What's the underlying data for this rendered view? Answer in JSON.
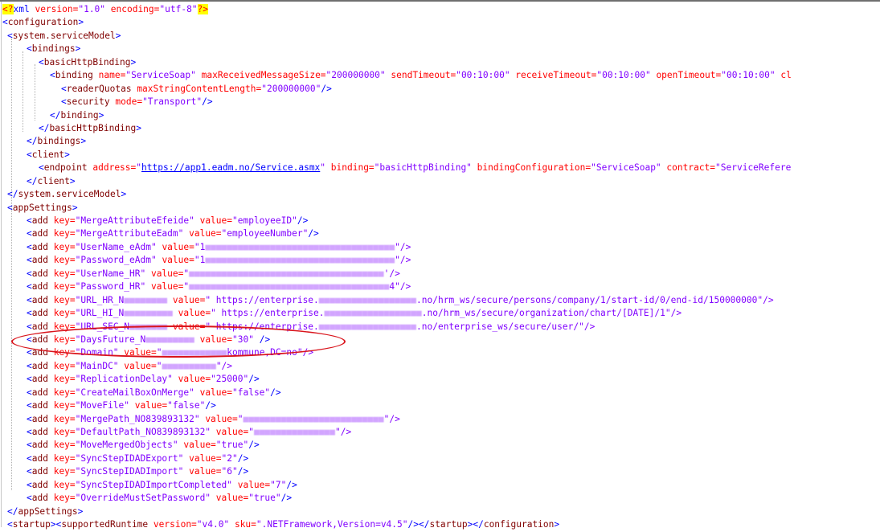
{
  "xml_decl": {
    "lt": "<",
    "q": "?",
    "name": "xml",
    "version": " version=",
    "version_val": "\"1.0\"",
    "encoding": " encoding=",
    "encoding_val": "\"utf-8\"",
    "end": "?>"
  },
  "lines": {
    "configuration": "configuration",
    "system_serviceModel": "system.serviceModel",
    "bindings": "bindings",
    "basicHttpBinding": "basicHttpBinding",
    "binding": "binding",
    "name_attr": " name=",
    "name_val": "\"ServiceSoap\"",
    "maxReceived_attr": " maxReceivedMessageSize=",
    "maxReceived_val": "\"200000000\"",
    "sendTimeout_attr": " sendTimeout=",
    "sendTimeout_val": "\"00:10:00\"",
    "receiveTimeout_attr": " receiveTimeout=",
    "receiveTimeout_val": "\"00:10:00\"",
    "openTimeout_attr": " openTimeout=",
    "openTimeout_val": "\"00:10:00\"",
    "closeTrunc": " cl",
    "readerQuotas": "readerQuotas",
    "maxString_attr": " maxStringContentLength=",
    "maxString_val": "\"200000000\"",
    "security": "security",
    "mode_attr": " mode=",
    "mode_val": "\"Transport\"",
    "client": "client",
    "endpoint": "endpoint",
    "address_attr": " address=",
    "address_url": "https://app1.eadm.no/Service.asmx",
    "bindingAttr": " binding=",
    "bindingVal": "\"basicHttpBinding\"",
    "bindingConfigAttr": " bindingConfiguration=",
    "bindingConfigVal": "\"ServiceSoap\"",
    "contractAttr": " contract=",
    "contractVal": "\"ServiceRefere",
    "appSettings": "appSettings",
    "add": "add",
    "key_attr": " key=",
    "value_attr": " value="
  },
  "settings": [
    {
      "key": "\"MergeAttributeEfeide\"",
      "value": "\"employeeID\""
    },
    {
      "key": "\"MergeAttributeEadm\"",
      "value": "\"employeeNumber\""
    },
    {
      "key": "\"UserName_eAdm\"",
      "value": "\"1",
      "tail": "\"/>"
    },
    {
      "key": "\"Password_eAdm\"",
      "value": "\"1",
      "tail": "\"/>"
    },
    {
      "key": "\"UserName_HR\"",
      "value": "\"",
      "tail": "'/>"
    },
    {
      "key": "\"Password_HR\"",
      "value": "\"",
      "tail": "4\"/>"
    },
    {
      "key": "\"URL_HR_N",
      "value": "\" https://enterprise.",
      "tail": ".no/hrm_ws/secure/persons/company/1/start-id/0/end-id/150000000\"/>"
    },
    {
      "key": "\"URL_HI_N",
      "value": "\" https://enterprise.",
      "tail": ".no/hrm_ws/secure/organization/chart/[DATE]/1\"/>"
    },
    {
      "key": "\"URL_SEC_N",
      "value": "\" https://enterprise.",
      "tail": ".no/enterprise_ws/secure/user/\"/>"
    },
    {
      "key": "\"DaysFuture_N",
      "value": "\"30\"",
      "tail": " />"
    },
    {
      "key": "\"Domain\"",
      "value": "\"",
      "tail": "kommune,DC=no\"/>"
    },
    {
      "key": "\"MainDC\"",
      "value": "\"",
      "tail": "\"/>"
    },
    {
      "key": "\"ReplicationDelay\"",
      "value": "\"25000\""
    },
    {
      "key": "\"CreateMailBoxOnMerge\"",
      "value": "\"false\""
    },
    {
      "key": "\"MoveFile\"",
      "value": "\"false\""
    },
    {
      "key": "\"MergePath_NO839893132\"",
      "value": "\"",
      "tail": "\"/>"
    },
    {
      "key": "\"DefaultPath_NO839893132\"",
      "value": "\"",
      "tail": "\"/>"
    },
    {
      "key": "\"MoveMergedObjects\"",
      "value": "\"true\""
    },
    {
      "key": "\"SyncStepIDADExport\"",
      "value": "\"2\""
    },
    {
      "key": "\"SyncStepIDADImport\"",
      "value": "\"6\""
    },
    {
      "key": "\"SyncStepIDADImportCompleted\"",
      "value": "\"7\""
    },
    {
      "key": "\"OverrideMustSetPassword\"",
      "value": "\"true\""
    }
  ],
  "startup": {
    "startup": "startup",
    "supportedRuntime": "supportedRuntime",
    "version_attr": " version=",
    "version_val": "\"v4.0\"",
    "sku_attr": " sku=",
    "sku_val": "\".NETFramework,Version=v4.5\""
  },
  "colors": {
    "bracket": "#0000ff",
    "tag": "#800000",
    "attr": "#ff0000",
    "string": "#8000ff",
    "annotation": "#d9141c"
  }
}
